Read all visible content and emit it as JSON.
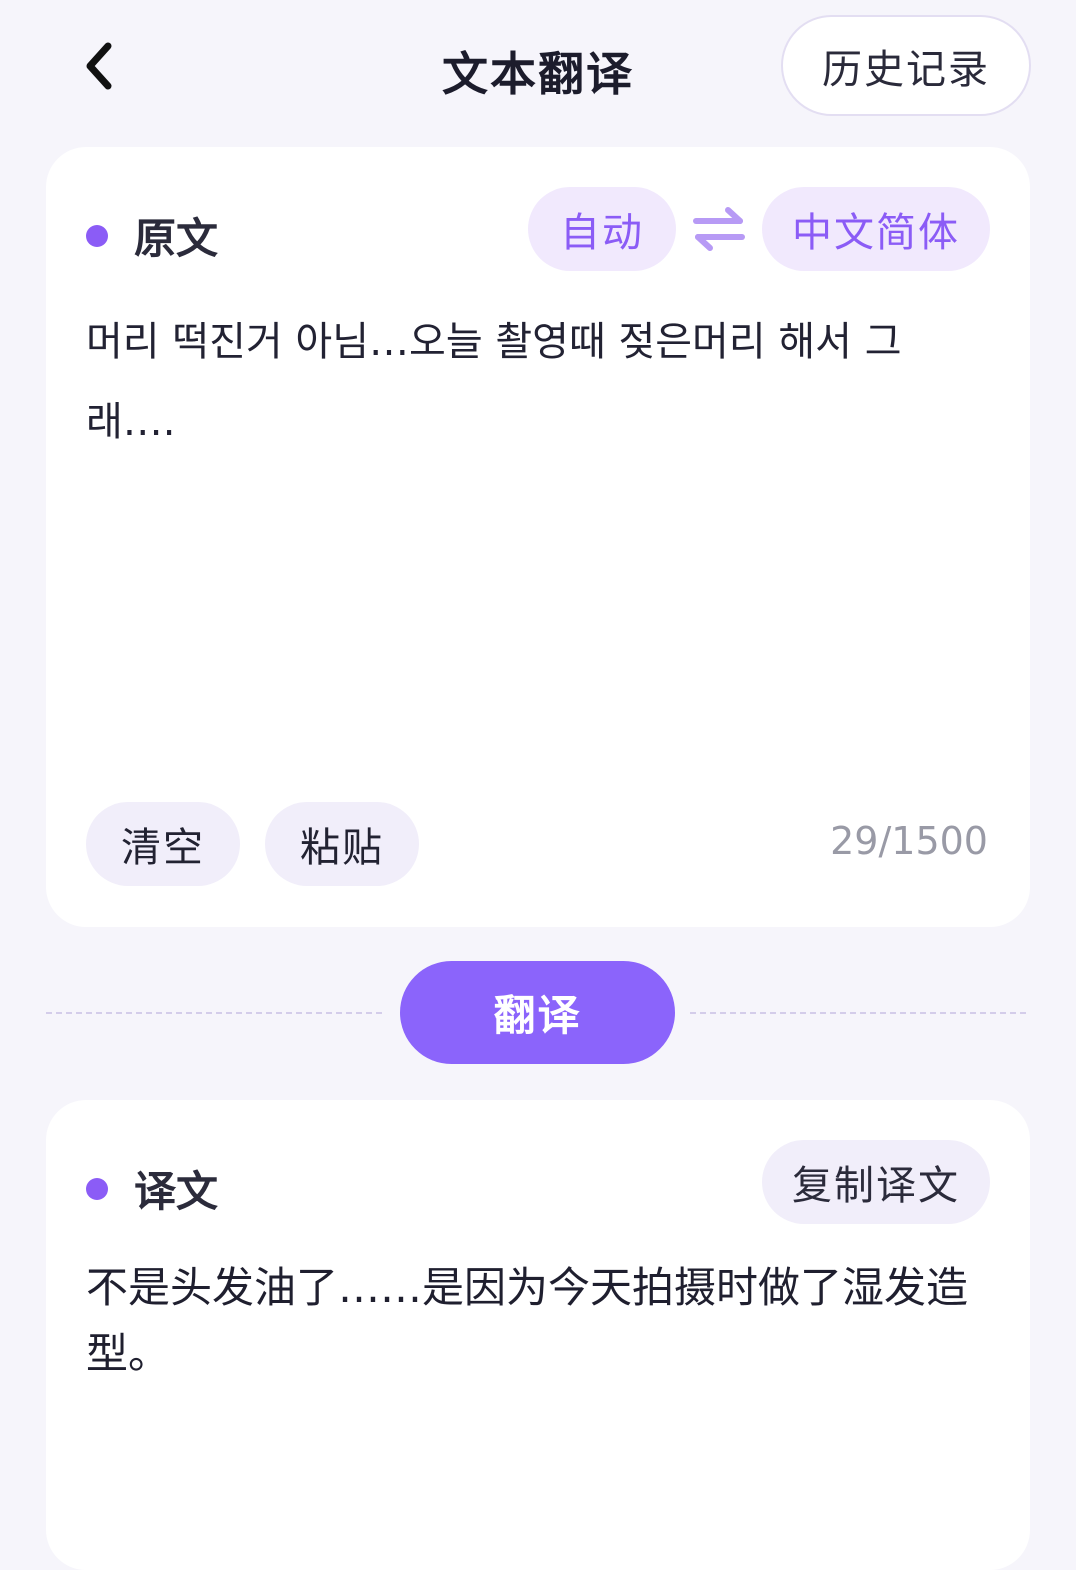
{
  "header": {
    "title": "文本翻译",
    "history_label": "历史记录"
  },
  "source": {
    "label": "原文",
    "from_lang": "自动",
    "to_lang": "中文简体",
    "text": "머리 떡진거 아님…오늘 촬영때 젖은머리 해서 그래….",
    "clear_label": "清空",
    "paste_label": "粘贴",
    "char_count": "29/1500"
  },
  "translate_label": "翻译",
  "target": {
    "label": "译文",
    "copy_label": "复制译文",
    "text": "不是头发油了……是因为今天拍摄时做了湿发造型。"
  },
  "colors": {
    "accent": "#8b5cf6",
    "button": "#8b64fb",
    "pill_bg": "#f1e9fd",
    "page_bg": "#f6f5fb"
  }
}
